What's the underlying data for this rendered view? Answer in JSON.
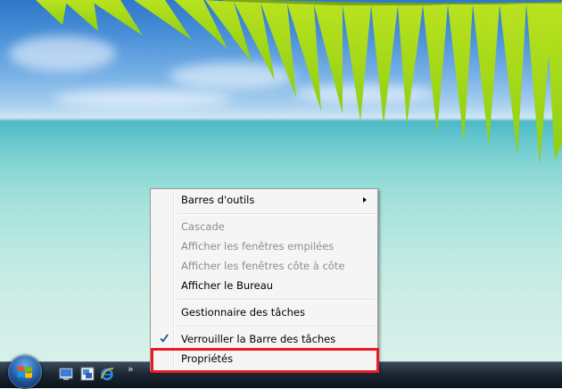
{
  "menu": {
    "items": [
      {
        "label": "Barres d'outils",
        "enabled": true,
        "submenu": true
      },
      {
        "label": "Cascade",
        "enabled": false
      },
      {
        "label": "Afficher les fenêtres empilées",
        "enabled": false
      },
      {
        "label": "Afficher les fenêtres côte à côte",
        "enabled": false
      },
      {
        "label": "Afficher le Bureau",
        "enabled": true
      },
      {
        "label": "Gestionnaire des tâches",
        "enabled": true
      },
      {
        "label": "Verrouiller la Barre des tâches",
        "enabled": true,
        "checked": true
      },
      {
        "label": "Propriétés",
        "enabled": true,
        "highlighted": true
      }
    ]
  },
  "taskbar": {
    "overflow_label": "»",
    "quick_launch": [
      "show-desktop-icon",
      "switch-windows-icon",
      "internet-explorer-icon"
    ]
  },
  "colors": {
    "highlight_outline": "#e81b22",
    "menu_background": "#f5f5f5",
    "disabled_text": "#8d8d8d"
  }
}
